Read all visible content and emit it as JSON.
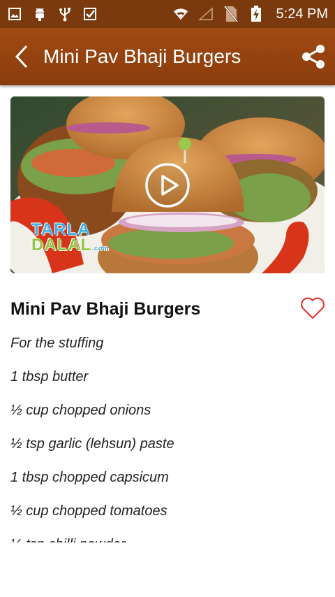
{
  "status_bar": {
    "time": "5:24 PM",
    "icons_left": [
      "image-icon",
      "android-icon",
      "usb-icon",
      "checkbox-icon"
    ],
    "icons_right": [
      "wifi-icon",
      "signal-icon",
      "no-sim-icon",
      "battery-charging-icon"
    ]
  },
  "app_bar": {
    "title": "Mini Pav Bhaji Burgers",
    "color": "#9a4511"
  },
  "video": {
    "watermark_line1": "TARLA",
    "watermark_line2": "DALAL",
    "watermark_suffix": ".com"
  },
  "recipe": {
    "title": "Mini Pav Bhaji Burgers",
    "ingredients": [
      "For the stuffing",
      "1 tbsp butter",
      "½ cup chopped onions",
      "½ tsp garlic (lehsun) paste",
      "1 tbsp chopped capsicum",
      "½ cup chopped tomatoes",
      "½ tsp chilli powder"
    ]
  }
}
